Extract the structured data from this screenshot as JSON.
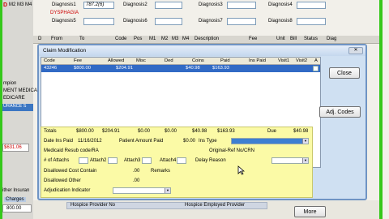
{
  "top_form": {
    "dx_code": "787.2(6)",
    "dx_desc": "DYSPHAGIA",
    "diagnosis1_label": "Diagnosis1",
    "diagnosis2_label": "Diagnosis2",
    "diagnosis3_label": "Diagnosis3",
    "diagnosis4_label": "Diagnosis4",
    "diagnosis5_label": "Diagnosis5",
    "diagnosis6_label": "Diagnosis6",
    "diagnosis7_label": "Diagnosis7",
    "diagnosis8_label": "Diagnosis8",
    "m_labels": [
      "M2",
      "M3",
      "M4"
    ]
  },
  "grid_header": [
    "D",
    "From",
    "To",
    "Code",
    "Pos",
    "M1",
    "M2",
    "M3",
    "M4",
    "Description",
    "Fee",
    "Unit",
    "Bill",
    "Status",
    "Diag"
  ],
  "sidebar": {
    "items": [
      "mpion",
      "MENT MEDICA",
      "EDICARE",
      "URANCE S"
    ],
    "amount": "$631.06",
    "insurance_label": "ither Insuran",
    "charges_label": "Charges",
    "charges_value": "800.00"
  },
  "dialog": {
    "title": "Claim Modification",
    "close_label": "Close",
    "adj_codes_label": "Adj. Codes",
    "columns": [
      "Code",
      "Fee",
      "Allowed",
      "Misc",
      "Ded",
      "Coins",
      "Paid",
      "Ins Paid",
      "Visit1",
      "Visit2",
      "A"
    ],
    "row": {
      "code": "43246",
      "fee": "$800.00",
      "allowed": "$204.91",
      "misc": "$0.00",
      "ded": "$0.00",
      "coins": "$40.98",
      "paid": "$163.93"
    },
    "totals": {
      "label": "Totals",
      "fee": "$800.00",
      "allowed": "$204.91",
      "misc": "$0.00",
      "ded": "$0.00",
      "coins": "$40.98",
      "paid": "$163.93",
      "due_label": "Due",
      "due": "$40.98"
    },
    "form": {
      "date_ins_paid_label": "Date Ins Paid",
      "date_ins_paid": "11/16/2012",
      "patient_amount_paid_label": "Patient Amount Paid",
      "patient_amount_paid": "$0.00",
      "ins_type_label": "Ins Type",
      "medicaid_label": "Medicaid Resub code/RA",
      "original_ref_label": "Original-Ref No/CRN",
      "attachs_label": "# of Attachs",
      "attach2_label": "Attach2",
      "attach3_label": "Attach3",
      "attach4_label": "Attach4",
      "delay_reason_label": "Delay Reason",
      "disallowed_cost_label": "Disallowed Cost Contain",
      "disallowed_cost": ".00",
      "remarks_label": "Remarks",
      "disallowed_other_label": "Disallowed Other",
      "disallowed_other": ".00",
      "adjudication_label": "Adjudication Indicator"
    }
  },
  "bottom": {
    "hospice_provider_label": "Hospice Provider No",
    "hospice_employed_label": "Hospice Employed Provider",
    "more_label": "More"
  },
  "colors": {
    "accent_green": "#35c81a",
    "selection_blue": "#316ac5",
    "panel_yellow": "#fbfaa6",
    "dysphagia_red": "#cc0000"
  }
}
